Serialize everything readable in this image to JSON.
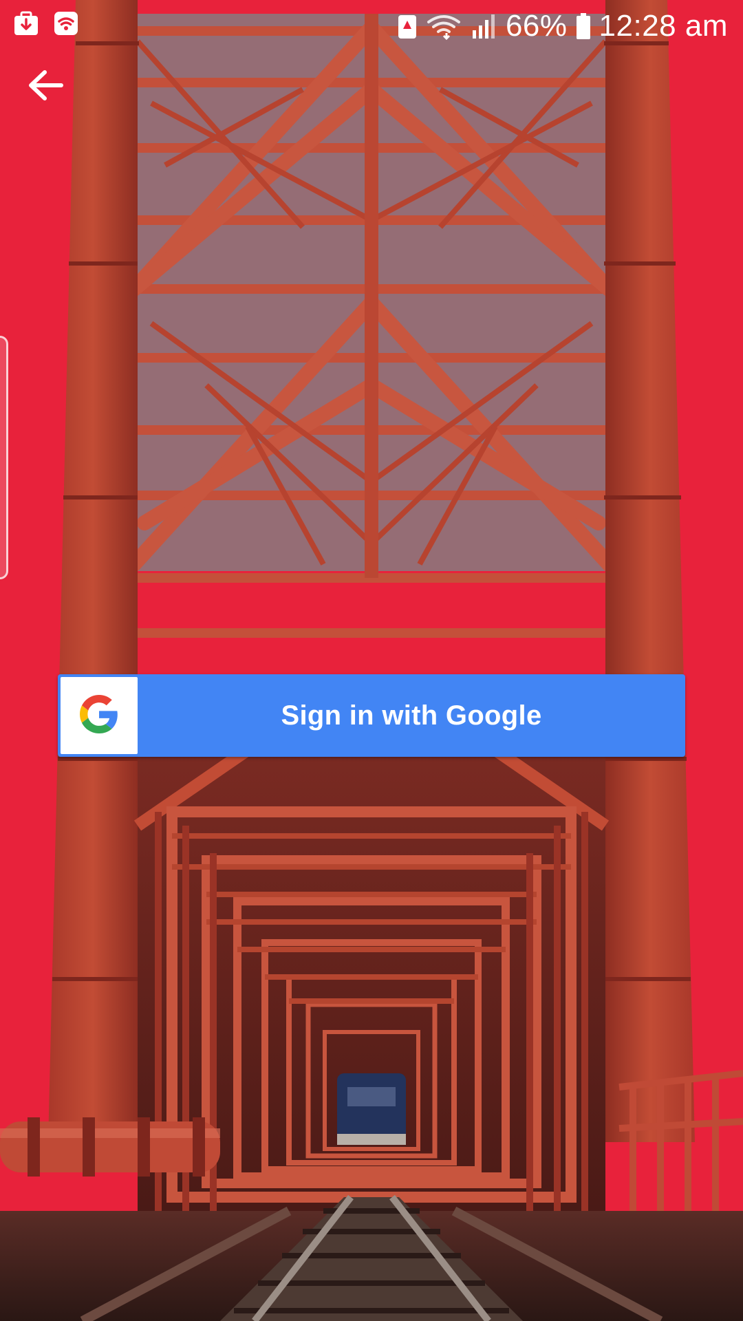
{
  "status_bar": {
    "battery": "66%",
    "time": "12:28 am",
    "left_icons": [
      "download-notification-icon",
      "wifi-notification-icon"
    ],
    "right_icons": [
      "data-saver-icon",
      "wifi-icon",
      "signal-icon",
      "battery-icon"
    ]
  },
  "toolbar": {
    "back_icon": "arrow-left-icon"
  },
  "sign_in": {
    "label": "Sign in with Google",
    "icon": "google-g-icon"
  },
  "colors": {
    "background": "#e8223b",
    "bridge_steel": "#b8412f",
    "google_blue": "#4285f4",
    "sky": "#8fb1d6"
  }
}
